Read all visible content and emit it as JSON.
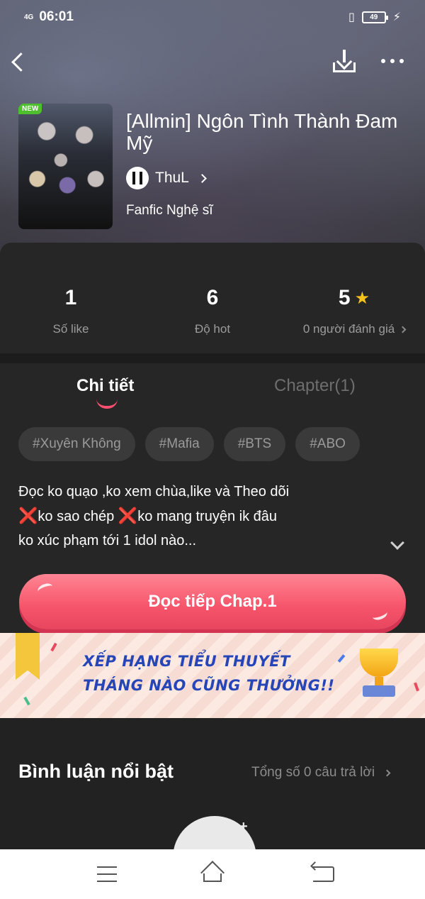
{
  "status_bar": {
    "network": "4G",
    "time": "06:01",
    "battery": "49"
  },
  "book": {
    "badge": "NEW",
    "title": "[Allmin] Ngôn Tình Thành Đam Mỹ",
    "author": "ThuL",
    "genre": "Fanfic Nghệ sĩ"
  },
  "stats": [
    {
      "value": "1",
      "label": "Số like"
    },
    {
      "value": "6",
      "label": "Độ hot"
    },
    {
      "value": "5",
      "label": "0 người đánh giá"
    }
  ],
  "tabs": [
    {
      "label": "Chi tiết",
      "active": true
    },
    {
      "label": "Chapter(1)",
      "active": false
    }
  ],
  "tags": [
    "#Xuyên Không",
    "#Mafia",
    "#BTS",
    "#ABO"
  ],
  "description": {
    "line1": "Đọc ko quạo ,ko xem chùa,like và Theo dõi",
    "line2_part1": "ko sao chép ",
    "line2_part2": "ko mang truyện ik đâu",
    "line3": "ko xúc phạm tới 1 idol nào...",
    "mark": "❌"
  },
  "read_button": "Đọc tiếp Chap.1",
  "banner": {
    "line1": "XẾP HẠNG TIỂU THUYẾT",
    "line2": "THÁNG NÀO CŨNG THƯỞNG!!"
  },
  "comments": {
    "title": "Bình luận nổi bật",
    "count_text": "Tổng số 0 câu trả lời"
  },
  "icons": {
    "back": "back-arrow-icon",
    "download": "download-icon",
    "more": "more-dots-icon",
    "star": "star-icon"
  },
  "colors": {
    "accent": "#f6546a",
    "star": "#f6c21c",
    "tag_bg": "#3a3a3a",
    "banner_text": "#2646b8",
    "new_badge": "#4ec02e"
  }
}
